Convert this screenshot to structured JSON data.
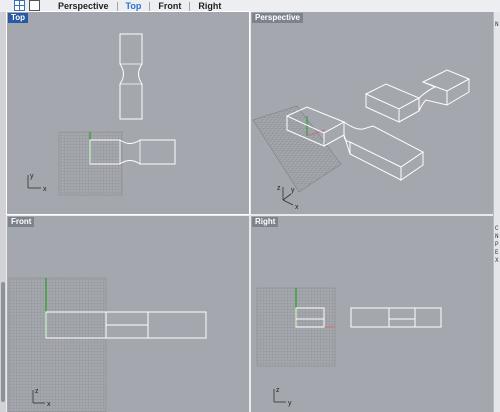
{
  "toolbar": {
    "tabs": [
      {
        "label": "Perspective",
        "active": false
      },
      {
        "label": "Top",
        "active": true
      },
      {
        "label": "Front",
        "active": false
      },
      {
        "label": "Right",
        "active": false
      }
    ],
    "icons": [
      "viewport-layout-icon",
      "maximize-viewport-icon"
    ]
  },
  "viewports": {
    "top": {
      "label": "Top",
      "active": true,
      "axis_y": "y",
      "axis_x": "x"
    },
    "perspective": {
      "label": "Perspective",
      "active": false,
      "axis_z": "z",
      "axis_y": "y",
      "axis_x": "x"
    },
    "front": {
      "label": "Front",
      "active": false,
      "axis_z": "z",
      "axis_x": "x"
    },
    "right": {
      "label": "Right",
      "active": false,
      "axis_z": "z",
      "axis_y": "y"
    }
  },
  "side_panel": {
    "chars": [
      "N",
      "C",
      "N",
      "P",
      "E",
      "X"
    ]
  },
  "colors": {
    "viewport_bg": "#a4a7ad",
    "wireframe": "#ffffff",
    "grid": "#8b8e93",
    "axis_x": "#c87070",
    "axis_y": "#3ca03c",
    "active_label": "#275aa3"
  }
}
